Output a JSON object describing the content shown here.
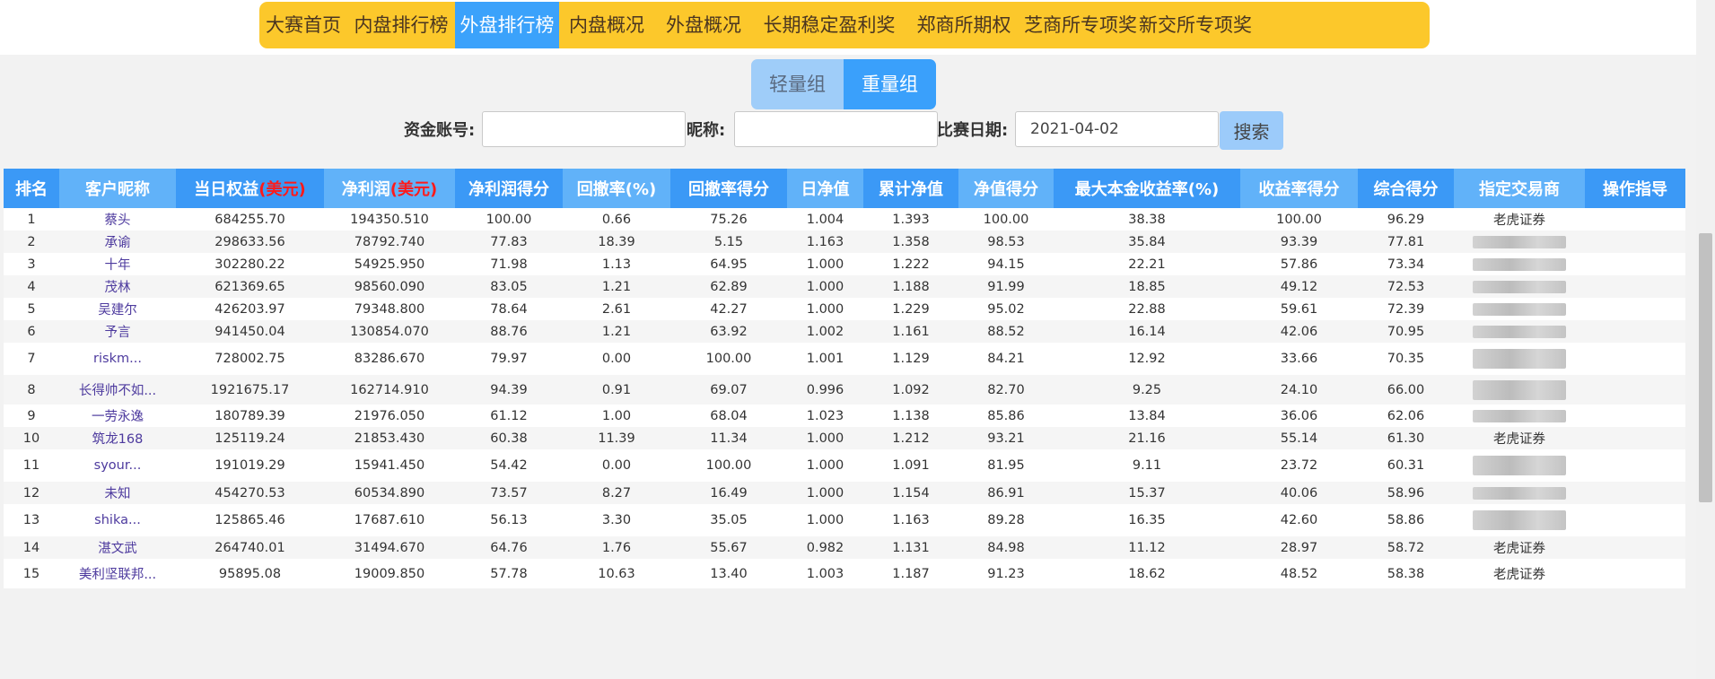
{
  "nav": {
    "items": [
      "大赛首页",
      "内盘排行榜",
      "外盘排行榜",
      "内盘概况",
      "外盘概况",
      "长期稳定盈利奖",
      "郑商所期权",
      "芝商所专项奖",
      "新交所专项奖"
    ],
    "active_index": 2
  },
  "group_toggle": {
    "light_label": "轻量组",
    "heavy_label": "重量组",
    "active": "重量组"
  },
  "search": {
    "account_label": "资金账号:",
    "account_value": "",
    "nickname_label": "昵称:",
    "nickname_value": "",
    "date_label": "比赛日期:",
    "date_value": "2021-04-02",
    "search_label": "搜索"
  },
  "table": {
    "headers": [
      "排名",
      "客户昵称",
      "当日权益",
      "净利润",
      "净利润得分",
      "回撤率(%)",
      "回撤率得分",
      "日净值",
      "累计净值",
      "净值得分",
      "最大本金收益率(%)",
      "收益率得分",
      "综合得分",
      "指定交易商",
      "操作指导"
    ],
    "currency_suffix": "(美元)",
    "rows": [
      {
        "rank": "1",
        "nickname": "蔡头",
        "equity": "684255.70",
        "net_profit": "194350.510",
        "profit_score": "100.00",
        "drawdown": "0.66",
        "drawdown_score": "75.26",
        "daily_nav": "1.004",
        "cum_nav": "1.393",
        "nav_score": "100.00",
        "max_return": "38.38",
        "return_score": "100.00",
        "total_score": "96.29",
        "broker": "老虎证券",
        "guide": ""
      },
      {
        "rank": "2",
        "nickname": "承谕",
        "equity": "298633.56",
        "net_profit": "78792.740",
        "profit_score": "77.83",
        "drawdown": "18.39",
        "drawdown_score": "5.15",
        "daily_nav": "1.163",
        "cum_nav": "1.358",
        "nav_score": "98.53",
        "max_return": "35.84",
        "return_score": "93.39",
        "total_score": "77.81",
        "broker": "",
        "guide": ""
      },
      {
        "rank": "3",
        "nickname": "十年",
        "equity": "302280.22",
        "net_profit": "54925.950",
        "profit_score": "71.98",
        "drawdown": "1.13",
        "drawdown_score": "64.95",
        "daily_nav": "1.000",
        "cum_nav": "1.222",
        "nav_score": "94.15",
        "max_return": "22.21",
        "return_score": "57.86",
        "total_score": "73.34",
        "broker": "",
        "guide": ""
      },
      {
        "rank": "4",
        "nickname": "茂林",
        "equity": "621369.65",
        "net_profit": "98560.090",
        "profit_score": "83.05",
        "drawdown": "1.21",
        "drawdown_score": "62.89",
        "daily_nav": "1.000",
        "cum_nav": "1.188",
        "nav_score": "91.99",
        "max_return": "18.85",
        "return_score": "49.12",
        "total_score": "72.53",
        "broker": "",
        "guide": ""
      },
      {
        "rank": "5",
        "nickname": "吴建尔",
        "equity": "426203.97",
        "net_profit": "79348.800",
        "profit_score": "78.64",
        "drawdown": "2.61",
        "drawdown_score": "42.27",
        "daily_nav": "1.000",
        "cum_nav": "1.229",
        "nav_score": "95.02",
        "max_return": "22.88",
        "return_score": "59.61",
        "total_score": "72.39",
        "broker": "",
        "guide": ""
      },
      {
        "rank": "6",
        "nickname": "予言",
        "equity": "941450.04",
        "net_profit": "130854.070",
        "profit_score": "88.76",
        "drawdown": "1.21",
        "drawdown_score": "63.92",
        "daily_nav": "1.002",
        "cum_nav": "1.161",
        "nav_score": "88.52",
        "max_return": "16.14",
        "return_score": "42.06",
        "total_score": "70.95",
        "broker": "",
        "guide": ""
      },
      {
        "rank": "7",
        "nickname": "riskm...",
        "equity": "728002.75",
        "net_profit": "83286.670",
        "profit_score": "79.97",
        "drawdown": "0.00",
        "drawdown_score": "100.00",
        "daily_nav": "1.001",
        "cum_nav": "1.129",
        "nav_score": "84.21",
        "max_return": "12.92",
        "return_score": "33.66",
        "total_score": "70.35",
        "broker": "",
        "guide": ""
      },
      {
        "rank": "8",
        "nickname": "长得帅不如...",
        "equity": "1921675.17",
        "net_profit": "162714.910",
        "profit_score": "94.39",
        "drawdown": "0.91",
        "drawdown_score": "69.07",
        "daily_nav": "0.996",
        "cum_nav": "1.092",
        "nav_score": "82.70",
        "max_return": "9.25",
        "return_score": "24.10",
        "total_score": "66.00",
        "broker": "",
        "guide": ""
      },
      {
        "rank": "9",
        "nickname": "一劳永逸",
        "equity": "180789.39",
        "net_profit": "21976.050",
        "profit_score": "61.12",
        "drawdown": "1.00",
        "drawdown_score": "68.04",
        "daily_nav": "1.023",
        "cum_nav": "1.138",
        "nav_score": "85.86",
        "max_return": "13.84",
        "return_score": "36.06",
        "total_score": "62.06",
        "broker": "",
        "guide": ""
      },
      {
        "rank": "10",
        "nickname": "筑龙168",
        "equity": "125119.24",
        "net_profit": "21853.430",
        "profit_score": "60.38",
        "drawdown": "11.39",
        "drawdown_score": "11.34",
        "daily_nav": "1.000",
        "cum_nav": "1.212",
        "nav_score": "93.21",
        "max_return": "21.16",
        "return_score": "55.14",
        "total_score": "61.30",
        "broker": "老虎证券",
        "guide": ""
      },
      {
        "rank": "11",
        "nickname": "syour...",
        "equity": "191019.29",
        "net_profit": "15941.450",
        "profit_score": "54.42",
        "drawdown": "0.00",
        "drawdown_score": "100.00",
        "daily_nav": "1.000",
        "cum_nav": "1.091",
        "nav_score": "81.95",
        "max_return": "9.11",
        "return_score": "23.72",
        "total_score": "60.31",
        "broker": "",
        "guide": ""
      },
      {
        "rank": "12",
        "nickname": "未知",
        "equity": "454270.53",
        "net_profit": "60534.890",
        "profit_score": "73.57",
        "drawdown": "8.27",
        "drawdown_score": "16.49",
        "daily_nav": "1.000",
        "cum_nav": "1.154",
        "nav_score": "86.91",
        "max_return": "15.37",
        "return_score": "40.06",
        "total_score": "58.96",
        "broker": "",
        "guide": ""
      },
      {
        "rank": "13",
        "nickname": "shika...",
        "equity": "125865.46",
        "net_profit": "17687.610",
        "profit_score": "56.13",
        "drawdown": "3.30",
        "drawdown_score": "35.05",
        "daily_nav": "1.000",
        "cum_nav": "1.163",
        "nav_score": "89.28",
        "max_return": "16.35",
        "return_score": "42.60",
        "total_score": "58.86",
        "broker": "",
        "guide": ""
      },
      {
        "rank": "14",
        "nickname": "湛文武",
        "equity": "264740.01",
        "net_profit": "31494.670",
        "profit_score": "64.76",
        "drawdown": "1.76",
        "drawdown_score": "55.67",
        "daily_nav": "0.982",
        "cum_nav": "1.131",
        "nav_score": "84.98",
        "max_return": "11.12",
        "return_score": "28.97",
        "total_score": "58.72",
        "broker": "老虎证券",
        "guide": ""
      },
      {
        "rank": "15",
        "nickname": "美利坚联邦...",
        "equity": "95895.08",
        "net_profit": "19009.850",
        "profit_score": "57.78",
        "drawdown": "10.63",
        "drawdown_score": "13.40",
        "daily_nav": "1.003",
        "cum_nav": "1.187",
        "nav_score": "91.23",
        "max_return": "18.62",
        "return_score": "48.52",
        "total_score": "58.38",
        "broker": "老虎证券",
        "guide": ""
      }
    ]
  },
  "colors": {
    "nav_bg": "#fcc82b",
    "nav_active": "#3ba2fb",
    "header_blue": "#3b99f6",
    "header_light": "#61b2f9",
    "currency_red": "#ff1a1a",
    "nickname": "#4d3a9e"
  }
}
